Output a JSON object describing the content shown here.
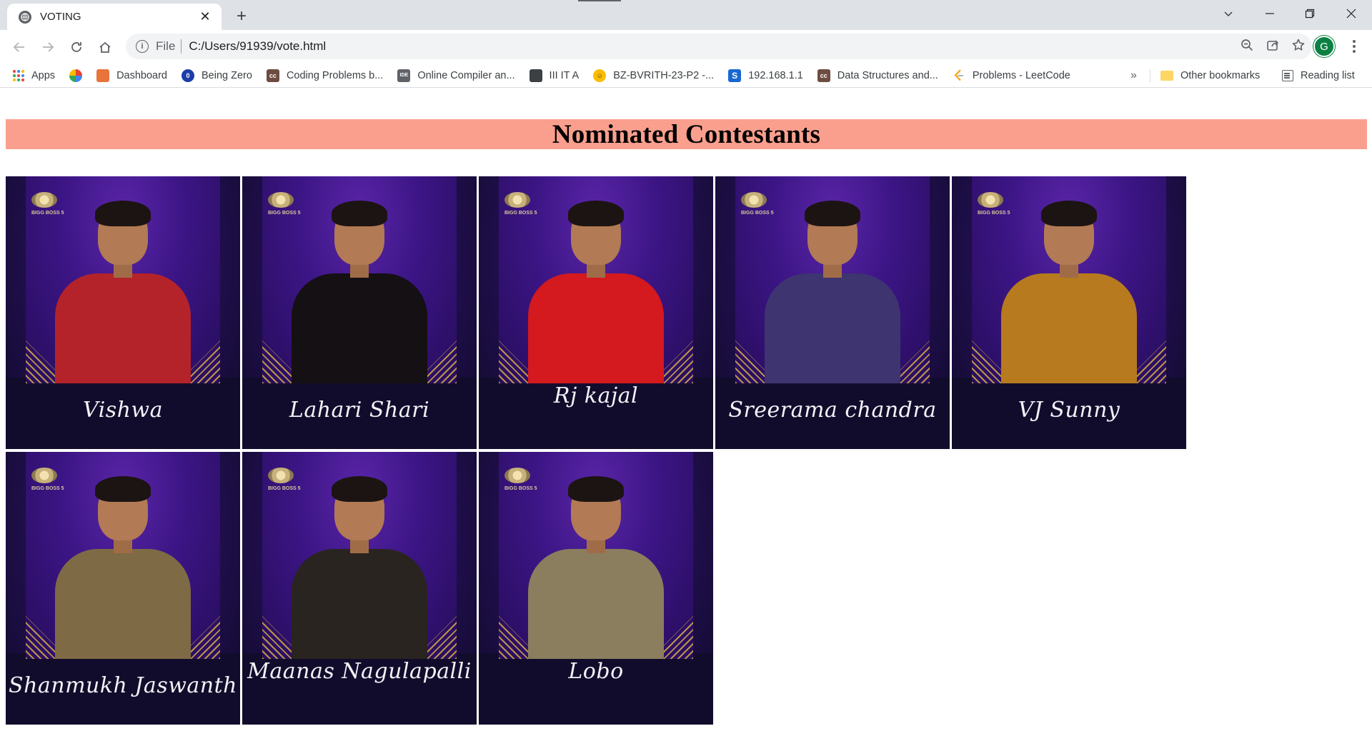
{
  "tab": {
    "title": "VOTING",
    "close": "✕",
    "new": "+"
  },
  "window": {
    "minimize": "─",
    "maximize": "❐",
    "close": "✕",
    "tab_search": "⌄"
  },
  "address_bar": {
    "scheme": "File",
    "url": "C:/Users/91939/vote.html"
  },
  "profile": {
    "initial": "G"
  },
  "bookmarks": {
    "items": [
      {
        "label": "Apps",
        "icon": "apps-grid-icon"
      },
      {
        "label": "",
        "icon": "multicolor-app-icon"
      },
      {
        "label": "Dashboard",
        "icon": "dashboard-icon",
        "color": "#e8743b"
      },
      {
        "label": "Being Zero",
        "icon": "being-zero-icon",
        "color": "#1a3ea8"
      },
      {
        "label": "Coding Problems b...",
        "icon": "cc-icon",
        "color": "#6d4c41"
      },
      {
        "label": "Online Compiler an...",
        "icon": "ide-icon",
        "color": "#5f6368"
      },
      {
        "label": "III IT A",
        "icon": "classroom-icon",
        "color": "#3c4043"
      },
      {
        "label": "BZ-BVRITH-23-P2 -...",
        "icon": "smiley-icon",
        "color": "#fbbc04"
      },
      {
        "label": "192.168.1.1",
        "icon": "s-icon",
        "color": "#1967d2"
      },
      {
        "label": "Data Structures and...",
        "icon": "cc-icon-2",
        "color": "#6d4c41"
      },
      {
        "label": "Problems - LeetCode",
        "icon": "leetcode-icon",
        "color": "#ffa116"
      }
    ],
    "more": "»",
    "other": "Other bookmarks",
    "reading": "Reading list"
  },
  "page": {
    "heading": "Nominated Contestants",
    "banner_color": "#fa9f8e",
    "contestants": [
      {
        "name": "Vishwa",
        "outfit": "#b4232a"
      },
      {
        "name": "Lahari Shari",
        "outfit": "#141014"
      },
      {
        "name": "Rj kajal",
        "outfit": "#d4191f"
      },
      {
        "name": "Sreerama chandra",
        "outfit": "#3e3470"
      },
      {
        "name": "VJ Sunny",
        "outfit": "#b77a1e"
      },
      {
        "name": "Shanmukh Jaswanth",
        "outfit": "#7e6a45"
      },
      {
        "name": "Maanas Nagulapalli",
        "outfit": "#2a2420"
      },
      {
        "name": "Lobo",
        "outfit": "#8a7e5e"
      }
    ],
    "logo_text": "BIGG BOSS 5"
  }
}
